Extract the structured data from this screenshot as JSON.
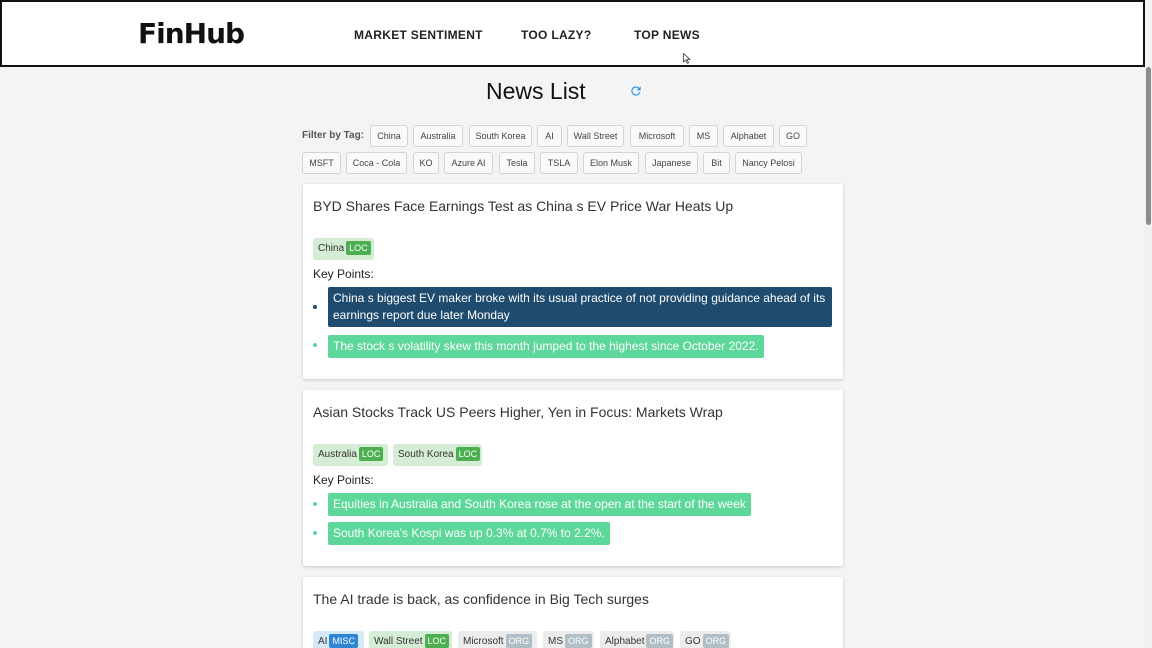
{
  "nav": {
    "logo": "FinHub",
    "links": [
      "MARKET SENTIMENT",
      "TOO LAZY?",
      "TOP NEWS"
    ]
  },
  "page": {
    "title": "News List",
    "filter_label": "Filter by Tag:"
  },
  "filter_tags": {
    "row1": [
      "China",
      "Australia",
      "South Korea",
      "AI",
      "Wall Street",
      "Microsoft",
      "MS",
      "Alphabet",
      "GO"
    ],
    "row2": [
      "MSFT",
      "Coca - Cola",
      "KO",
      "Azure AI",
      "Tesla",
      "TSLA",
      "Elon Musk",
      "Japanese",
      "Bit",
      "Nancy Pelosi"
    ]
  },
  "key_points_label": "Key Points:",
  "articles": [
    {
      "title": "BYD Shares Face Earnings Test as China s EV Price War Heats Up",
      "tags": [
        {
          "name": "China",
          "type": "LOC"
        }
      ],
      "key_points": [
        "China s biggest EV maker broke with its usual practice of not providing guidance ahead of its earnings report due later Monday",
        "The stock s volatility skew this month jumped to the highest since October 2022."
      ]
    },
    {
      "title": "Asian Stocks Track US Peers Higher, Yen in Focus: Markets Wrap",
      "tags": [
        {
          "name": "Australia",
          "type": "LOC"
        },
        {
          "name": "South Korea",
          "type": "LOC"
        }
      ],
      "key_points": [
        "Equities in Australia and South Korea rose at the open at the start of the week",
        "South Korea's Kospi was up 0.3% at 0.7% to 2.2%."
      ]
    },
    {
      "title": "The AI trade is back, as confidence in Big Tech surges",
      "tags": [
        {
          "name": "AI",
          "type": "MISC"
        },
        {
          "name": "Wall Street",
          "type": "LOC"
        },
        {
          "name": "Microsoft",
          "type": "ORG"
        },
        {
          "name": "MS",
          "type": "ORG"
        },
        {
          "name": "Alphabet",
          "type": "ORG"
        },
        {
          "name": "GO",
          "type": "ORG"
        }
      ]
    }
  ]
}
